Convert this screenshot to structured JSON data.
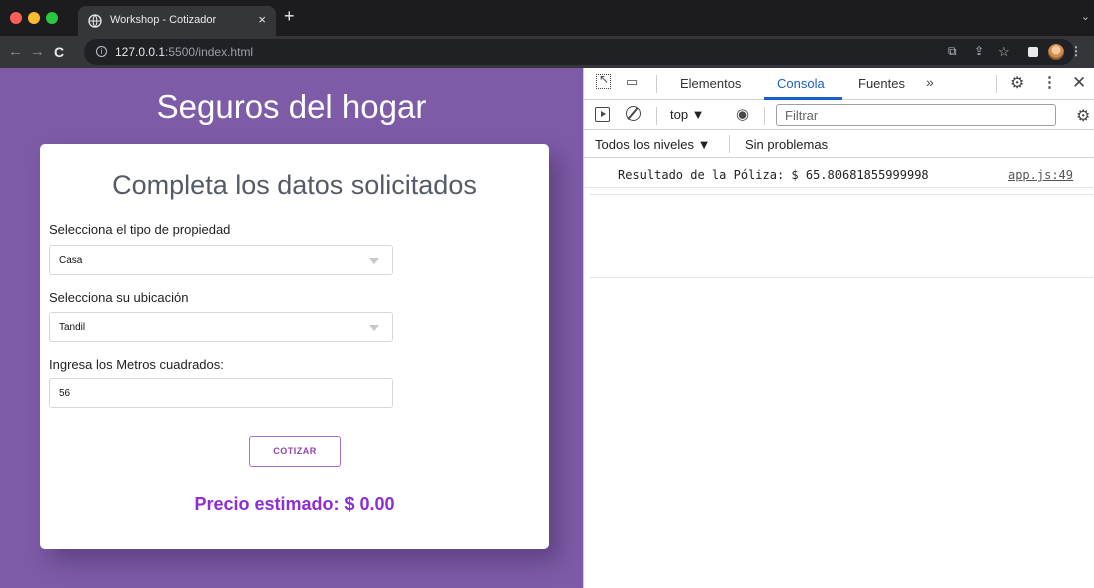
{
  "browser": {
    "tab_title": "Workshop - Cotizador",
    "tab_close": "×",
    "new_tab": "+",
    "url_host": "127.0.0.1",
    "url_path": ":5500/index.html"
  },
  "page": {
    "title": "Seguros del hogar",
    "form_heading": "Completa los datos solicitados",
    "property_label": "Selecciona el tipo de propiedad",
    "property_value": "Casa",
    "location_label": "Selecciona su ubicación",
    "location_value": "Tandil",
    "meters_label": "Ingresa los Metros cuadrados:",
    "meters_value": "56",
    "quote_button": "COTIZAR",
    "estimate": "Precio estimado: $ 0.00",
    "colors": {
      "background": "#7d5ba6",
      "accent": "#8e2cd6"
    }
  },
  "devtools": {
    "tabs": [
      "Elementos",
      "Consola",
      "Fuentes"
    ],
    "active_tab": "Consola",
    "context": "top ▼",
    "filter_placeholder": "Filtrar",
    "levels": "Todos los niveles ▼",
    "problems": "Sin problemas",
    "log_message": "Resultado de la Póliza: $ 65.80681855999998",
    "log_source": "app.js:49"
  }
}
